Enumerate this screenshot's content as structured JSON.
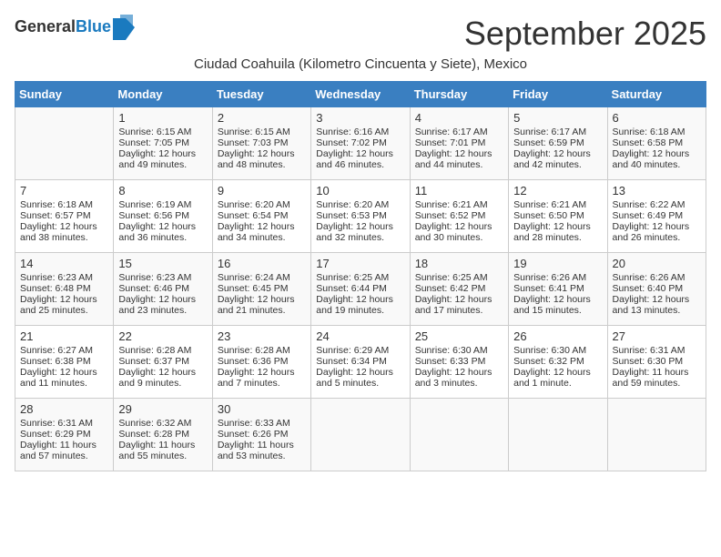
{
  "header": {
    "logo_line1": "General",
    "logo_line2": "Blue",
    "month_title": "September 2025",
    "subtitle": "Ciudad Coahuila (Kilometro Cincuenta y Siete), Mexico"
  },
  "days_of_week": [
    "Sunday",
    "Monday",
    "Tuesday",
    "Wednesday",
    "Thursday",
    "Friday",
    "Saturday"
  ],
  "weeks": [
    [
      {
        "day": "",
        "sunrise": "",
        "sunset": "",
        "daylight": ""
      },
      {
        "day": "1",
        "sunrise": "Sunrise: 6:15 AM",
        "sunset": "Sunset: 7:05 PM",
        "daylight": "Daylight: 12 hours and 49 minutes."
      },
      {
        "day": "2",
        "sunrise": "Sunrise: 6:15 AM",
        "sunset": "Sunset: 7:03 PM",
        "daylight": "Daylight: 12 hours and 48 minutes."
      },
      {
        "day": "3",
        "sunrise": "Sunrise: 6:16 AM",
        "sunset": "Sunset: 7:02 PM",
        "daylight": "Daylight: 12 hours and 46 minutes."
      },
      {
        "day": "4",
        "sunrise": "Sunrise: 6:17 AM",
        "sunset": "Sunset: 7:01 PM",
        "daylight": "Daylight: 12 hours and 44 minutes."
      },
      {
        "day": "5",
        "sunrise": "Sunrise: 6:17 AM",
        "sunset": "Sunset: 6:59 PM",
        "daylight": "Daylight: 12 hours and 42 minutes."
      },
      {
        "day": "6",
        "sunrise": "Sunrise: 6:18 AM",
        "sunset": "Sunset: 6:58 PM",
        "daylight": "Daylight: 12 hours and 40 minutes."
      }
    ],
    [
      {
        "day": "7",
        "sunrise": "Sunrise: 6:18 AM",
        "sunset": "Sunset: 6:57 PM",
        "daylight": "Daylight: 12 hours and 38 minutes."
      },
      {
        "day": "8",
        "sunrise": "Sunrise: 6:19 AM",
        "sunset": "Sunset: 6:56 PM",
        "daylight": "Daylight: 12 hours and 36 minutes."
      },
      {
        "day": "9",
        "sunrise": "Sunrise: 6:20 AM",
        "sunset": "Sunset: 6:54 PM",
        "daylight": "Daylight: 12 hours and 34 minutes."
      },
      {
        "day": "10",
        "sunrise": "Sunrise: 6:20 AM",
        "sunset": "Sunset: 6:53 PM",
        "daylight": "Daylight: 12 hours and 32 minutes."
      },
      {
        "day": "11",
        "sunrise": "Sunrise: 6:21 AM",
        "sunset": "Sunset: 6:52 PM",
        "daylight": "Daylight: 12 hours and 30 minutes."
      },
      {
        "day": "12",
        "sunrise": "Sunrise: 6:21 AM",
        "sunset": "Sunset: 6:50 PM",
        "daylight": "Daylight: 12 hours and 28 minutes."
      },
      {
        "day": "13",
        "sunrise": "Sunrise: 6:22 AM",
        "sunset": "Sunset: 6:49 PM",
        "daylight": "Daylight: 12 hours and 26 minutes."
      }
    ],
    [
      {
        "day": "14",
        "sunrise": "Sunrise: 6:23 AM",
        "sunset": "Sunset: 6:48 PM",
        "daylight": "Daylight: 12 hours and 25 minutes."
      },
      {
        "day": "15",
        "sunrise": "Sunrise: 6:23 AM",
        "sunset": "Sunset: 6:46 PM",
        "daylight": "Daylight: 12 hours and 23 minutes."
      },
      {
        "day": "16",
        "sunrise": "Sunrise: 6:24 AM",
        "sunset": "Sunset: 6:45 PM",
        "daylight": "Daylight: 12 hours and 21 minutes."
      },
      {
        "day": "17",
        "sunrise": "Sunrise: 6:25 AM",
        "sunset": "Sunset: 6:44 PM",
        "daylight": "Daylight: 12 hours and 19 minutes."
      },
      {
        "day": "18",
        "sunrise": "Sunrise: 6:25 AM",
        "sunset": "Sunset: 6:42 PM",
        "daylight": "Daylight: 12 hours and 17 minutes."
      },
      {
        "day": "19",
        "sunrise": "Sunrise: 6:26 AM",
        "sunset": "Sunset: 6:41 PM",
        "daylight": "Daylight: 12 hours and 15 minutes."
      },
      {
        "day": "20",
        "sunrise": "Sunrise: 6:26 AM",
        "sunset": "Sunset: 6:40 PM",
        "daylight": "Daylight: 12 hours and 13 minutes."
      }
    ],
    [
      {
        "day": "21",
        "sunrise": "Sunrise: 6:27 AM",
        "sunset": "Sunset: 6:38 PM",
        "daylight": "Daylight: 12 hours and 11 minutes."
      },
      {
        "day": "22",
        "sunrise": "Sunrise: 6:28 AM",
        "sunset": "Sunset: 6:37 PM",
        "daylight": "Daylight: 12 hours and 9 minutes."
      },
      {
        "day": "23",
        "sunrise": "Sunrise: 6:28 AM",
        "sunset": "Sunset: 6:36 PM",
        "daylight": "Daylight: 12 hours and 7 minutes."
      },
      {
        "day": "24",
        "sunrise": "Sunrise: 6:29 AM",
        "sunset": "Sunset: 6:34 PM",
        "daylight": "Daylight: 12 hours and 5 minutes."
      },
      {
        "day": "25",
        "sunrise": "Sunrise: 6:30 AM",
        "sunset": "Sunset: 6:33 PM",
        "daylight": "Daylight: 12 hours and 3 minutes."
      },
      {
        "day": "26",
        "sunrise": "Sunrise: 6:30 AM",
        "sunset": "Sunset: 6:32 PM",
        "daylight": "Daylight: 12 hours and 1 minute."
      },
      {
        "day": "27",
        "sunrise": "Sunrise: 6:31 AM",
        "sunset": "Sunset: 6:30 PM",
        "daylight": "Daylight: 11 hours and 59 minutes."
      }
    ],
    [
      {
        "day": "28",
        "sunrise": "Sunrise: 6:31 AM",
        "sunset": "Sunset: 6:29 PM",
        "daylight": "Daylight: 11 hours and 57 minutes."
      },
      {
        "day": "29",
        "sunrise": "Sunrise: 6:32 AM",
        "sunset": "Sunset: 6:28 PM",
        "daylight": "Daylight: 11 hours and 55 minutes."
      },
      {
        "day": "30",
        "sunrise": "Sunrise: 6:33 AM",
        "sunset": "Sunset: 6:26 PM",
        "daylight": "Daylight: 11 hours and 53 minutes."
      },
      {
        "day": "",
        "sunrise": "",
        "sunset": "",
        "daylight": ""
      },
      {
        "day": "",
        "sunrise": "",
        "sunset": "",
        "daylight": ""
      },
      {
        "day": "",
        "sunrise": "",
        "sunset": "",
        "daylight": ""
      },
      {
        "day": "",
        "sunrise": "",
        "sunset": "",
        "daylight": ""
      }
    ]
  ]
}
